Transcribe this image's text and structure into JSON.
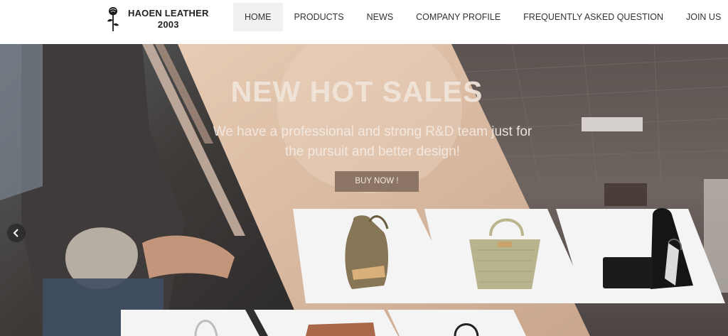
{
  "brand": {
    "name_line1": "HAOEN LEATHER",
    "name_line2": "2003"
  },
  "nav": {
    "items": [
      {
        "label": "HOME",
        "active": true
      },
      {
        "label": "PRODUCTS",
        "active": false
      },
      {
        "label": "NEWS",
        "active": false
      },
      {
        "label": "COMPANY PROFILE",
        "active": false
      },
      {
        "label": "FREQUENTLY ASKED QUESTION",
        "active": false
      },
      {
        "label": "JOIN US",
        "active": false
      }
    ]
  },
  "hero": {
    "title": "NEW HOT SALES",
    "subtitle": "We have a professional and strong R&D team just for the pursuit and better design!",
    "button_label": "BUY NOW !",
    "accent_color": "#8c7565",
    "products": [
      {
        "name": "olive-backpack-image"
      },
      {
        "name": "woven-handbag-image"
      },
      {
        "name": "black-tote-set-image"
      },
      {
        "name": "white-bag-image"
      },
      {
        "name": "brown-bag-image"
      },
      {
        "name": "black-bag-image"
      }
    ]
  },
  "icons": {
    "logo": "rose-icon",
    "carousel_prev": "chevron-left-icon"
  }
}
